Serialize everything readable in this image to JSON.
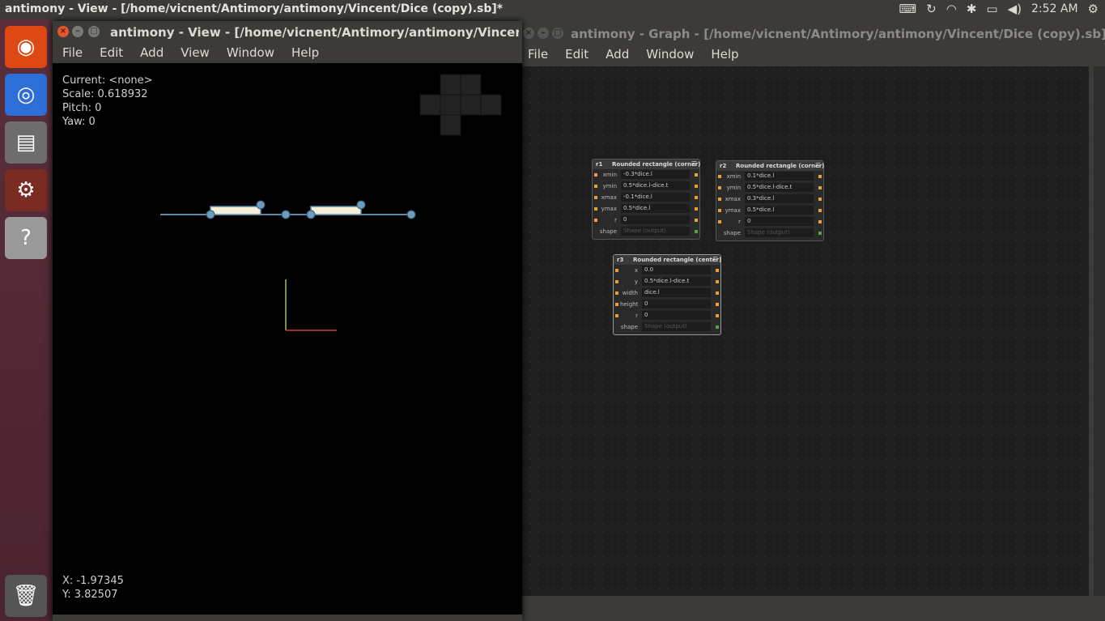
{
  "topbar": {
    "title": "antimony - View - [/home/vicnent/Antimory/antimony/Vincent/Dice (copy).sb]*",
    "clock": "2:52 AM"
  },
  "view_window": {
    "title": "antimony - View - [/home/vicnent/Antimory/antimony/Vincent/Dice (c",
    "menu": [
      "File",
      "Edit",
      "Add",
      "View",
      "Window",
      "Help"
    ],
    "current": "Current: <none>",
    "scale": "Scale: 0.618932",
    "pitch": "Pitch: 0",
    "yaw": "Yaw: 0",
    "x_coord": "X: -1.97345",
    "y_coord": "Y: 3.82507"
  },
  "graph_window": {
    "title": "antimony - Graph - [/home/vicnent/Antimory/antimony/Vincent/Dice (copy).sb]*",
    "menu": [
      "File",
      "Edit",
      "Add",
      "Window",
      "Help"
    ],
    "nodes": [
      {
        "name": "r1",
        "title": "Rounded rectangle (corner)",
        "rows": [
          {
            "label": "xmin",
            "value": "-0.3*dice.l"
          },
          {
            "label": "ymin",
            "value": "0.5*dice.l-dice.t"
          },
          {
            "label": "xmax",
            "value": "-0.1*dice.l"
          },
          {
            "label": "ymax",
            "value": "0.5*dice.l"
          },
          {
            "label": "r",
            "value": "0"
          },
          {
            "label": "shape",
            "value": "Shape (output)"
          }
        ]
      },
      {
        "name": "r2",
        "title": "Rounded rectangle (corner)",
        "rows": [
          {
            "label": "xmin",
            "value": "0.1*dice.l"
          },
          {
            "label": "ymin",
            "value": "0.5*dice.l-dice.t"
          },
          {
            "label": "xmax",
            "value": "0.3*dice.l"
          },
          {
            "label": "ymax",
            "value": "0.5*dice.l"
          },
          {
            "label": "r",
            "value": "0"
          },
          {
            "label": "shape",
            "value": "Shape (output)"
          }
        ]
      },
      {
        "name": "r3",
        "title": "Rounded rectangle (center)",
        "rows": [
          {
            "label": "x",
            "value": "0.0"
          },
          {
            "label": "y",
            "value": "0.5*dice.l-dice.t"
          },
          {
            "label": "width",
            "value": "dice.l"
          },
          {
            "label": "height",
            "value": "0"
          },
          {
            "label": "r",
            "value": "0"
          },
          {
            "label": "shape",
            "value": "Shape (output)"
          }
        ]
      }
    ]
  },
  "colors": {
    "accent": "#e8a13a",
    "window_bg": "#3c3b37",
    "close_button": "#e2572f"
  }
}
